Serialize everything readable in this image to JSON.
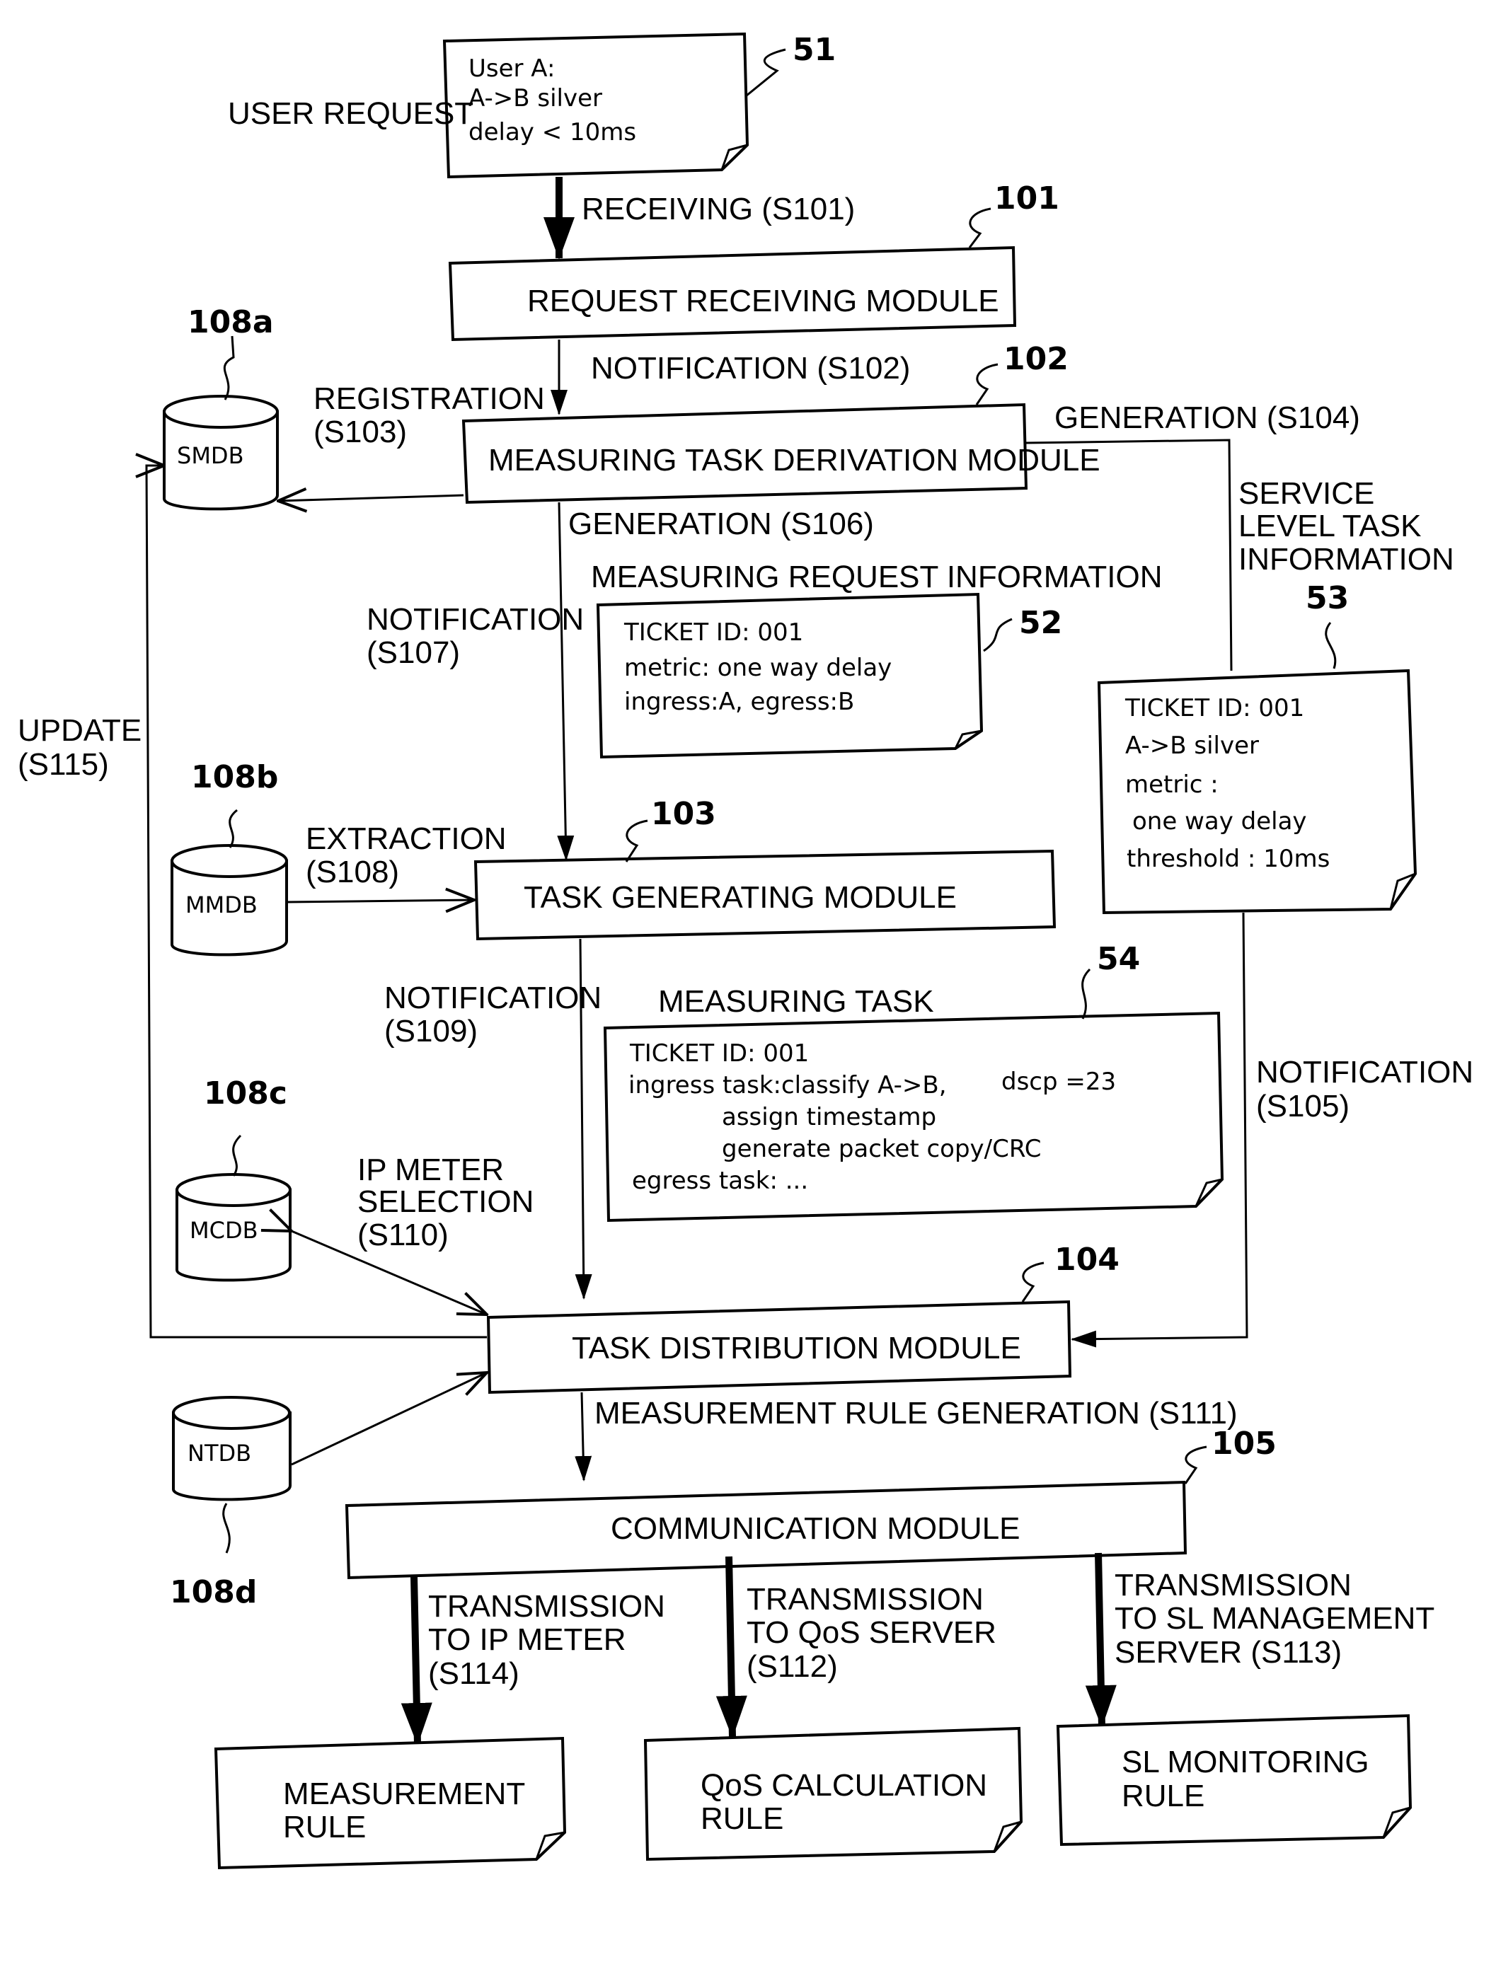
{
  "figure": {
    "user_request": {
      "label": "USER REQUEST",
      "ref": "51",
      "lines": [
        "User A:",
        "A->B silver",
        "delay < 10ms"
      ]
    },
    "modules": {
      "request_receiving": {
        "label": "REQUEST RECEIVING MODULE",
        "ref": "101"
      },
      "measuring_task_derivation": {
        "label": "MEASURING TASK DERIVATION MODULE",
        "ref": "102"
      },
      "task_generating": {
        "label": "TASK GENERATING MODULE",
        "ref": "103"
      },
      "task_distribution": {
        "label": "TASK DISTRIBUTION MODULE",
        "ref": "104"
      },
      "communication": {
        "label": "COMMUNICATION MODULE",
        "ref": "105"
      }
    },
    "databases": {
      "smdb": {
        "label": "SMDB",
        "ref": "108a"
      },
      "mmdb": {
        "label": "MMDB",
        "ref": "108b"
      },
      "mcdb": {
        "label": "MCDB",
        "ref": "108c"
      },
      "ntdb": {
        "label": "NTDB",
        "ref": "108d"
      }
    },
    "steps": {
      "s101": "RECEIVING (S101)",
      "s102": "NOTIFICATION (S102)",
      "s103": [
        "REGISTRATION",
        "(S103)"
      ],
      "s104": "GENERATION (S104)",
      "s105": [
        "NOTIFICATION",
        "(S105)"
      ],
      "s106": "GENERATION (S106)",
      "s107": [
        "NOTIFICATION",
        "(S107)"
      ],
      "s108": [
        "EXTRACTION",
        "(S108)"
      ],
      "s109": [
        "NOTIFICATION",
        "(S109)"
      ],
      "s110": [
        "IP METER",
        "SELECTION",
        "(S110)"
      ],
      "s111": "MEASUREMENT RULE GENERATION (S111)",
      "s112": [
        "TRANSMISSION",
        "TO QoS SERVER",
        "(S112)"
      ],
      "s113": [
        "TRANSMISSION",
        "TO SL MANAGEMENT",
        "SERVER (S113)"
      ],
      "s114": [
        "TRANSMISSION",
        "TO IP METER",
        "(S114)"
      ],
      "s115": [
        "UPDATE",
        "(S115)"
      ]
    },
    "measuring_request_info": {
      "title": "MEASURING REQUEST INFORMATION",
      "ref": "52",
      "lines": [
        "TICKET ID: 001",
        "metric: one way delay",
        "ingress:A, egress:B"
      ]
    },
    "service_level_task_info": {
      "title": [
        "SERVICE",
        "LEVEL TASK",
        "INFORMATION"
      ],
      "ref": "53",
      "lines": [
        "TICKET ID: 001",
        "A->B silver",
        "metric :",
        " one way delay",
        "threshold : 10ms"
      ]
    },
    "measuring_task": {
      "title": "MEASURING TASK",
      "ref": "54",
      "lines": [
        "TICKET ID: 001",
        "ingress task:classify A->B,",
        "assign timestamp",
        "generate packet copy/CRC",
        "egress task:    ..."
      ],
      "dscp": "dscp =23"
    },
    "outputs": {
      "measurement_rule": [
        "MEASUREMENT",
        "RULE"
      ],
      "qos_calculation_rule": [
        "QoS CALCULATION",
        "RULE"
      ],
      "sl_monitoring_rule": [
        "SL MONITORING",
        "RULE"
      ]
    }
  }
}
